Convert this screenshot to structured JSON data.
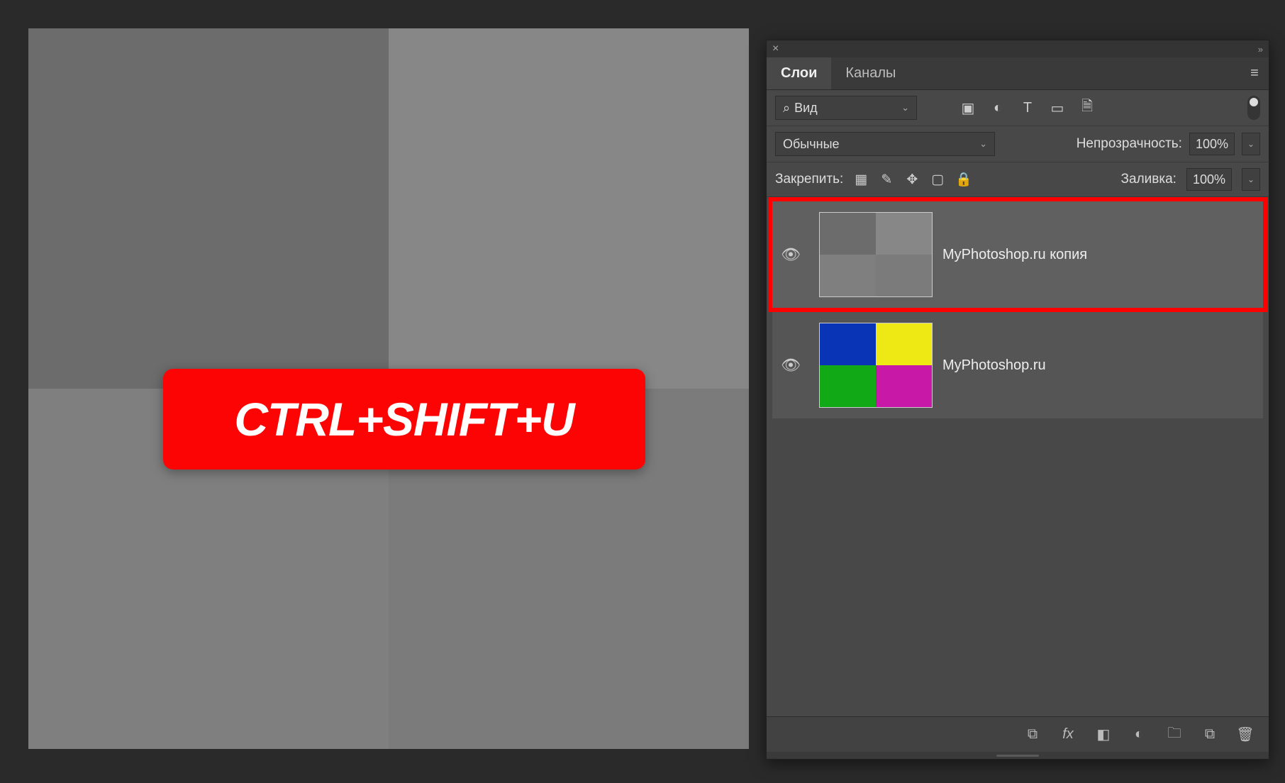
{
  "overlay": {
    "shortcut": "CTRL+SHIFT+U"
  },
  "panel": {
    "tabs": {
      "layers": "Слои",
      "channels": "Каналы"
    },
    "filter": {
      "label": "Вид"
    },
    "blend": {
      "mode": "Обычные",
      "opacity_label": "Непрозрачность:",
      "opacity_value": "100%"
    },
    "lock": {
      "label": "Закрепить:",
      "fill_label": "Заливка:",
      "fill_value": "100%"
    },
    "layers": [
      {
        "name": "MyPhotoshop.ru копия",
        "selected": true,
        "thumb": {
          "tl": "#6c6c6c",
          "tr": "#878787",
          "bl": "#7f7f7f",
          "br": "#7b7b7b"
        }
      },
      {
        "name": "MyPhotoshop.ru",
        "selected": false,
        "thumb": {
          "tl": "#0a34b6",
          "tr": "#eee815",
          "bl": "#12a917",
          "br": "#c818a7"
        }
      }
    ]
  },
  "icons": {
    "close": "×",
    "collapse": "»",
    "menu": "≡",
    "search": "⌕",
    "image": "▣",
    "adjust": "◐",
    "type": "T",
    "shape": "▭",
    "smart": "🗎",
    "checker": "▦",
    "brush": "✎",
    "move": "✥",
    "crop": "▢",
    "lockpad": "🔒",
    "eye": "👁",
    "link": "⧉",
    "fx": "fx",
    "mask": "◧",
    "fill": "◐",
    "folder": "🗀",
    "new": "⧉",
    "trash": "🗑"
  }
}
